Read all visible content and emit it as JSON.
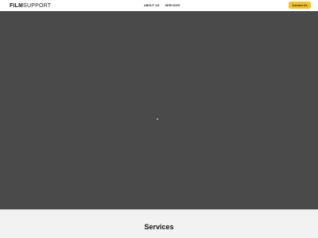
{
  "header": {
    "logo_bold": "FILM",
    "logo_light": "SUPPORT",
    "nav": [
      {
        "label": "ABOUT US"
      },
      {
        "label": "SERVICES"
      }
    ],
    "contact_label": "Contact Us"
  },
  "hero": {
    "background": "#4a4a4a"
  },
  "services": {
    "title": "Services"
  },
  "colors": {
    "accent": "#f5c226",
    "hero": "#4a4a4a",
    "section_bg": "#f2f2f2"
  }
}
